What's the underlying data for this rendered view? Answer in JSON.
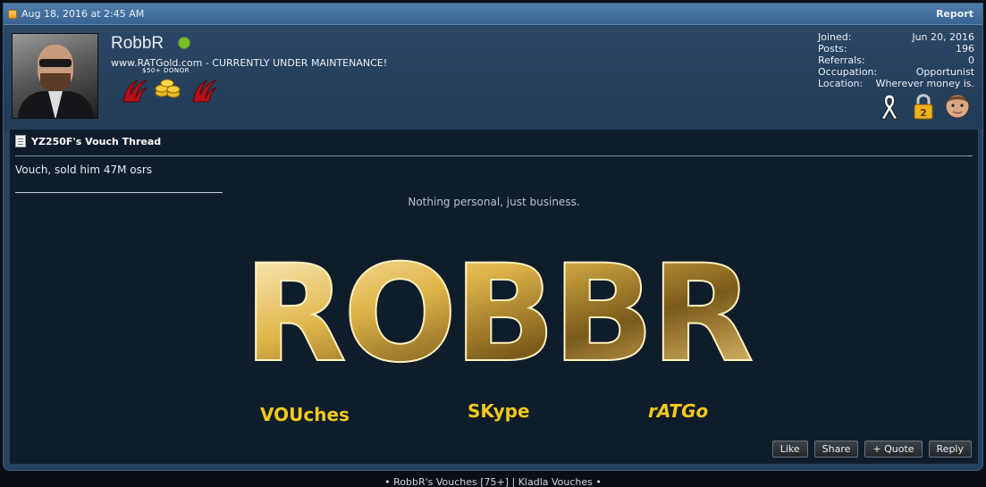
{
  "post": {
    "timestamp": "Aug 18, 2016 at 2:45 AM",
    "report_label": "Report"
  },
  "user": {
    "name": "RobbR",
    "title": "www.RATGold.com - CURRENTLY UNDER MAINTENANCE!",
    "donor_label": "$50+ DONOR",
    "status_color": "#7bc026"
  },
  "stats": [
    {
      "label": "Joined:",
      "value": "Jun 20, 2016"
    },
    {
      "label": "Posts:",
      "value": "196"
    },
    {
      "label": "Referrals:",
      "value": "0"
    },
    {
      "label": "Occupation:",
      "value": "Opportunist"
    },
    {
      "label": "Location:",
      "value": "Wherever money is."
    }
  ],
  "thread": {
    "title": "YZ250F's Vouch Thread",
    "message": "Vouch, sold him 47M osrs"
  },
  "signature": {
    "quote": "Nothing personal, just business.",
    "banner_title": "ROBBR",
    "links": [
      "VOUches",
      "SKype",
      "rATGo"
    ]
  },
  "actions": [
    "Like",
    "Share",
    "+ Quote",
    "Reply"
  ],
  "footer": "• RobbR's Vouches [75+] | Kladla Vouches •",
  "colors": {
    "accent": "#3a6491",
    "gold": "#e0b64a",
    "sig_link": "#f2c81e"
  }
}
